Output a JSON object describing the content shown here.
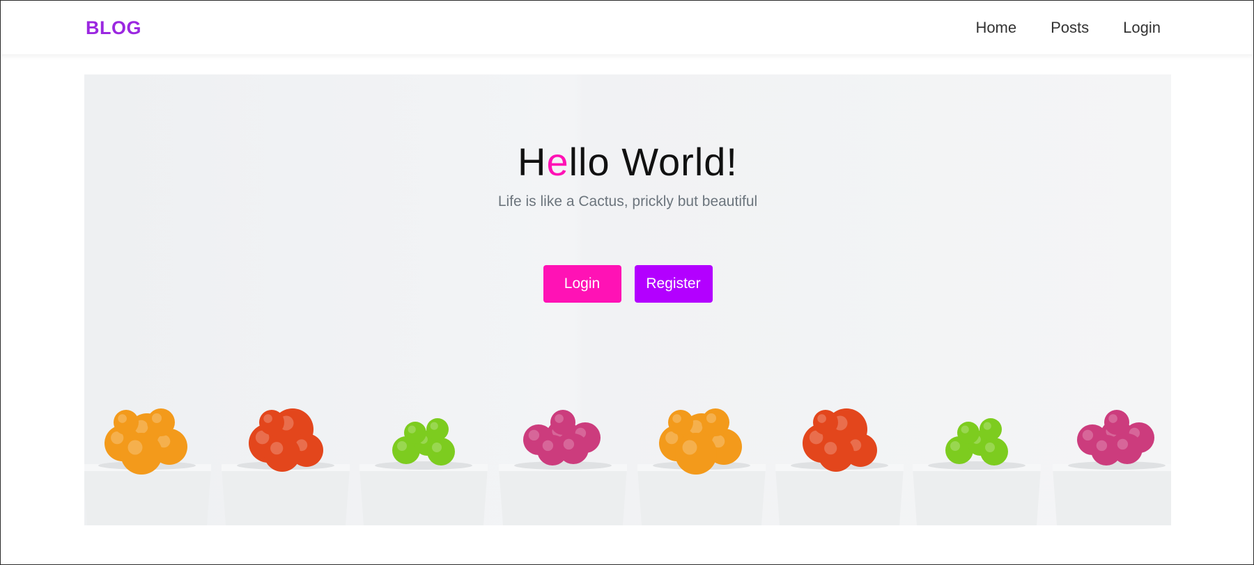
{
  "navbar": {
    "brand": "BLOG",
    "links": [
      {
        "label": "Home"
      },
      {
        "label": "Posts"
      },
      {
        "label": "Login"
      }
    ]
  },
  "hero": {
    "title_first": "H",
    "title_accent": "e",
    "title_rest": "llo World!",
    "subtitle": "Life is like a Cactus, prickly but beautiful",
    "login_label": "Login",
    "register_label": "Register"
  },
  "colors": {
    "brand": "#9b27e0",
    "accent_pink": "#ff12b5",
    "accent_purple": "#b300ff",
    "cactus_orange": "#f39a1b",
    "cactus_red": "#e3461c",
    "cactus_green": "#7dcc1f",
    "cactus_pink": "#cc3c7d",
    "pot_white": "#eceeef"
  },
  "image": {
    "subject": "row of potted cacti icons",
    "icon_names": [
      "cactus-orange-icon",
      "cactus-red-icon",
      "cactus-green-icon",
      "cactus-pink-icon"
    ]
  }
}
